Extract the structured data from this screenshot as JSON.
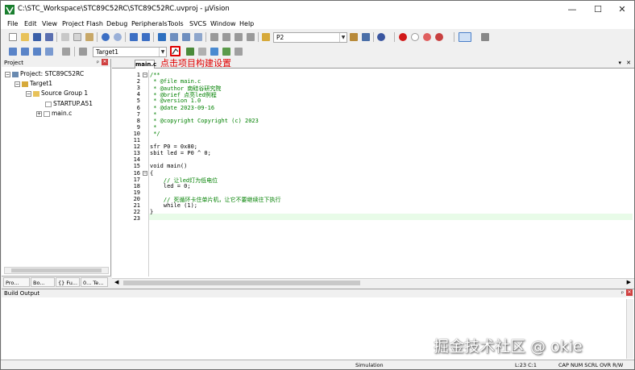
{
  "window": {
    "title": "C:\\STC_Workspace\\STC89C52RC\\STC89C52RC.uvproj - µVision",
    "minimize": "—",
    "maximize": "☐",
    "close": "✕"
  },
  "menu": [
    "File",
    "Edit",
    "View",
    "Project",
    "Flash",
    "Debug",
    "Peripherals",
    "Tools",
    "SVCS",
    "Window",
    "Help"
  ],
  "toolbar": {
    "find_combo": "P2",
    "target_combo": "Target1"
  },
  "project_panel": {
    "title": "Project",
    "pin": "ᵖ",
    "close": "✕",
    "tree": {
      "project": "Project: STC89C52RC",
      "target": "Target1",
      "group": "Source Group 1",
      "file1": "STARTUP.A51",
      "file2": "main.c"
    },
    "tabs": [
      "Pro...",
      "Bo...",
      "{} Fu...",
      "0... Te..."
    ]
  },
  "editor": {
    "tab": "main.c",
    "annotation": "点击项目构建设置",
    "lines": [
      {
        "n": "1",
        "fold": "⊟",
        "text": "/**",
        "cls": "c-com"
      },
      {
        "n": "2",
        "text": " * @file main.c",
        "cls": "c-com"
      },
      {
        "n": "3",
        "text": " * @author 南硅谷研究院",
        "cls": "c-com"
      },
      {
        "n": "4",
        "text": " * @brief 点亮led例程",
        "cls": "c-com"
      },
      {
        "n": "5",
        "text": " * @version 1.0",
        "cls": "c-com"
      },
      {
        "n": "6",
        "text": " * @date 2023-09-16",
        "cls": "c-com"
      },
      {
        "n": "7",
        "text": " *",
        "cls": "c-com"
      },
      {
        "n": "8",
        "text": " * @copyright Copyright (c) 2023",
        "cls": "c-com"
      },
      {
        "n": "9",
        "text": " *",
        "cls": "c-com"
      },
      {
        "n": "10",
        "text": " */",
        "cls": "c-com"
      },
      {
        "n": "11",
        "text": ""
      },
      {
        "n": "12",
        "text": "sfr P0 = 0x80;"
      },
      {
        "n": "13",
        "text": "sbit led = P0 ^ 0;"
      },
      {
        "n": "14",
        "text": ""
      },
      {
        "n": "15",
        "text": "void main()"
      },
      {
        "n": "16",
        "fold": "⊟",
        "text": "{"
      },
      {
        "n": "17",
        "text": "    // 让led灯为低电位",
        "cls": "c-com"
      },
      {
        "n": "18",
        "text": "    led = 0;"
      },
      {
        "n": "19",
        "text": ""
      },
      {
        "n": "20",
        "text": "    // 死循环卡住单片机，让它不要继续往下执行",
        "cls": "c-com"
      },
      {
        "n": "21",
        "text": "    while (1);"
      },
      {
        "n": "22",
        "text": "}"
      },
      {
        "n": "23",
        "text": ""
      }
    ]
  },
  "build_output": {
    "title": "Build Output"
  },
  "status": {
    "mode": "Simulation",
    "position": "L:23 C:1",
    "indicators": "CAP  NUM  SCRL  OVR  R/W"
  },
  "watermark": "掘金技术社区 @ okie"
}
